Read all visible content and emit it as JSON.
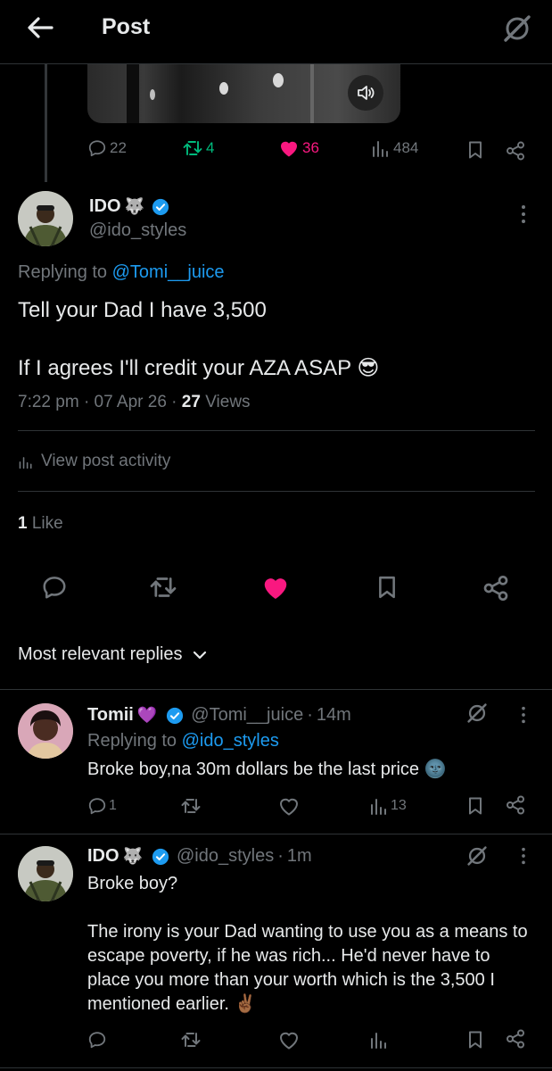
{
  "header": {
    "title": "Post"
  },
  "parent": {
    "stats": {
      "replies": "22",
      "reposts": "4",
      "likes": "36",
      "views": "484"
    }
  },
  "post": {
    "author_name": "IDO",
    "author_emoji": "🐺",
    "handle": "@ido_styles",
    "replying_prefix": "Replying to",
    "replying_to": "@Tomi__juice",
    "line1": "Tell your Dad I have 3,500",
    "line2": "If I agrees I'll credit your AZA ASAP",
    "line2_emoji": "😎",
    "time": "7:22 pm",
    "date": "07 Apr 26",
    "views_count": "27",
    "views_label": "Views",
    "activity_label": "View post activity",
    "likes_count": "1",
    "likes_label": "Like"
  },
  "sort": {
    "label": "Most relevant replies"
  },
  "replies": [
    {
      "name": "Tomii",
      "name_emoji": "💜",
      "handle": "@Tomi__juice",
      "time": "14m",
      "replying_prefix": "Replying to",
      "replying_to": "@ido_styles",
      "text": "Broke boy,na 30m dollars be the last price",
      "text_emoji": "🌚",
      "stats": {
        "replies": "1",
        "reposts": "",
        "likes": "",
        "views": "13"
      }
    },
    {
      "name": "IDO",
      "name_emoji": "🐺",
      "handle": "@ido_styles",
      "time": "1m",
      "text_p1": "Broke boy?",
      "text_p2": "The irony is your Dad wanting to use you as a means to escape poverty, if he was rich... He'd never have to place you more than your worth which is the 3,500 I mentioned earlier.",
      "text_emoji": "✌🏾",
      "stats": {
        "replies": "",
        "reposts": "",
        "likes": "",
        "views": ""
      }
    }
  ],
  "colors": {
    "like_pink": "#f91880",
    "repost_green": "#00ba7c",
    "link_blue": "#1d9bf0",
    "muted": "#71767b"
  }
}
